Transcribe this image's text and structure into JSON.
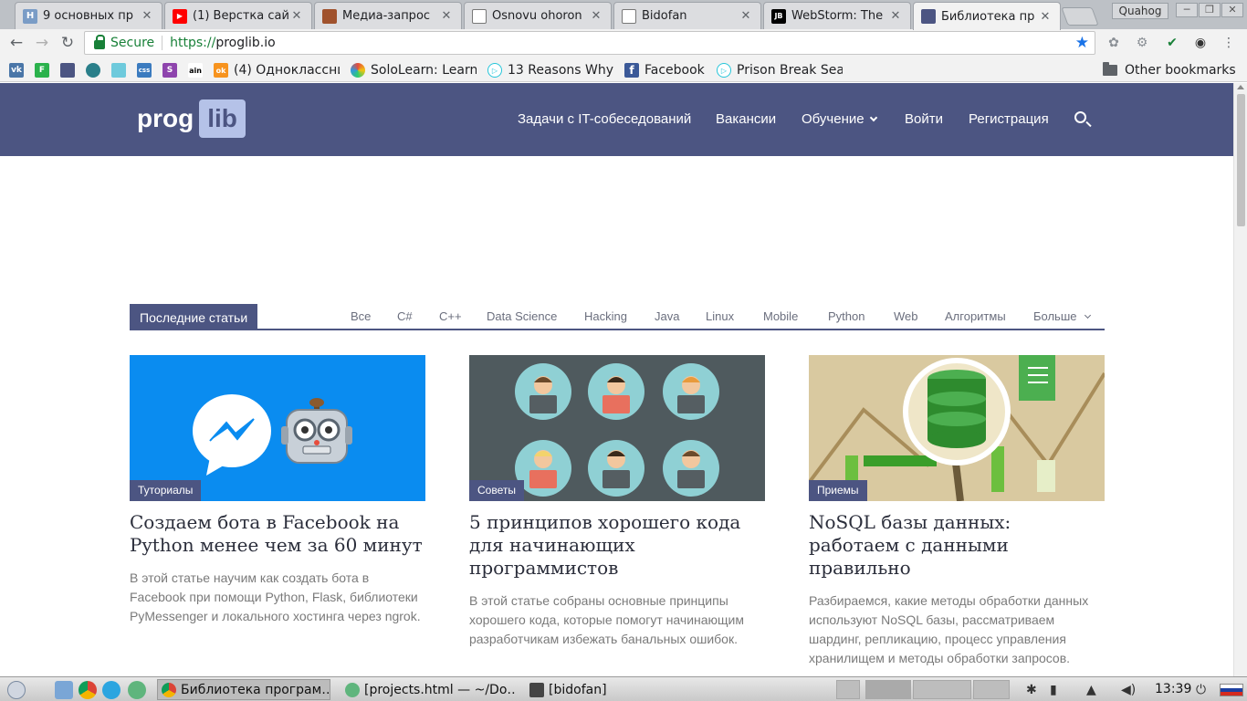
{
  "browser": {
    "tabs": [
      {
        "title": "9 основных пр",
        "icon": "habr-icon",
        "color": "#6c8ebf",
        "glyph": "H"
      },
      {
        "title": "(1) Верстка сай",
        "icon": "youtube-icon",
        "color": "#ff0000",
        "glyph": "▶"
      },
      {
        "title": "Медиа-запрос",
        "icon": "htmlbook-icon",
        "color": "#a0522d",
        "glyph": ""
      },
      {
        "title": "Osnovu ohoron",
        "icon": "page-icon",
        "color": "#ffffff",
        "glyph": ""
      },
      {
        "title": "Bidofan",
        "icon": "page-icon",
        "color": "#ffffff",
        "glyph": ""
      },
      {
        "title": "WebStorm: The",
        "icon": "jetbrains-icon",
        "color": "#000000",
        "glyph": "JB"
      },
      {
        "title": "Библиотека пр",
        "icon": "proglib-icon",
        "color": "#4c5582",
        "glyph": ""
      }
    ],
    "profile_name": "Quahog",
    "secure_label": "Secure",
    "url_scheme": "https://",
    "url_host": "proglib.io",
    "bookmarks": [
      {
        "label": "",
        "icon": "vk-icon",
        "color": "#4a76a8",
        "glyph": "vk"
      },
      {
        "label": "",
        "icon": "feedly-icon",
        "color": "#2bb24c",
        "glyph": "F"
      },
      {
        "label": "",
        "icon": "proglib-icon",
        "color": "#4c5582",
        "glyph": ""
      },
      {
        "label": "",
        "icon": "globe-icon",
        "color": "#2a7f8a",
        "glyph": ""
      },
      {
        "label": "",
        "icon": "slack-icon",
        "color": "#6ecadc",
        "glyph": ""
      },
      {
        "label": "",
        "icon": "css-icon",
        "color": "#3b7bbf",
        "glyph": "css"
      },
      {
        "label": "",
        "icon": "s-icon",
        "color": "#8e44ad",
        "glyph": "S"
      },
      {
        "label": "",
        "icon": "ain-icon",
        "color": "#ffffff",
        "glyph": "ain"
      },
      {
        "label": "(4) Одноклассни",
        "icon": "ok-icon",
        "color": "#f7931e",
        "glyph": "ok"
      },
      {
        "label": "SoloLearn: Learn",
        "icon": "sololearn-icon",
        "color": "#e74c3c",
        "glyph": ""
      },
      {
        "label": "13 Reasons Why",
        "icon": "play-icon",
        "color": "#26c6da",
        "glyph": "▷"
      },
      {
        "label": "Facebook",
        "icon": "facebook-icon",
        "color": "#3b5998",
        "glyph": "f"
      },
      {
        "label": "Prison Break Sea",
        "icon": "play-icon",
        "color": "#26c6da",
        "glyph": "▷"
      }
    ],
    "other_bookmarks": "Other bookmarks"
  },
  "site": {
    "logo_prog": "prog",
    "logo_lib": "lib",
    "nav": [
      "Задачи с IT-собеседований",
      "Вакансии",
      "Обучение",
      "Войти",
      "Регистрация"
    ],
    "section_title": "Последние статьи",
    "categories": [
      "Все",
      "C#",
      "C++",
      "Data Science",
      "Hacking",
      "Java",
      "Linux",
      "Mobile",
      "Python",
      "Web",
      "Алгоритмы",
      "Больше"
    ],
    "articles": [
      {
        "badge": "Туториалы",
        "title": "Создаем бота в Facebook на Python менее чем за 60 минут",
        "desc": "В этой статье научим как создать бота в Facebook при помощи Python, Flask, библиотеки PyMessenger и локального хостинга через ngrok."
      },
      {
        "badge": "Советы",
        "title": "5 принципов хорошего кода для начинающих программистов",
        "desc": "В этой статье собраны основные принципы хорошего кода, которые помогут начинающим разработчикам избежать банальных ошибок."
      },
      {
        "badge": "Приемы",
        "title": "NoSQL базы данных: работаем с данными правильно",
        "desc": "Разбираемся, какие методы обработки данных используют NoSQL базы, рассматриваем шардинг, репликацию, процесс управления хранилищем и методы обработки запросов."
      }
    ]
  },
  "taskbar": {
    "tasks": [
      {
        "label": "Библиотека програм…",
        "icon": "chrome-icon",
        "active": true
      },
      {
        "label": "[projects.html — ~/Do…",
        "icon": "atom-icon",
        "active": false
      },
      {
        "label": "[bidofan]",
        "icon": "folder-icon",
        "active": false
      }
    ],
    "clock": "13:39"
  },
  "colors": {
    "brand": "#4c5582",
    "logo_lib": "#b5c2e8",
    "messenger_bg": "#0a8cf0",
    "devs_bg": "#4f5a5e",
    "nosql_bg": "#d9c9a0"
  }
}
